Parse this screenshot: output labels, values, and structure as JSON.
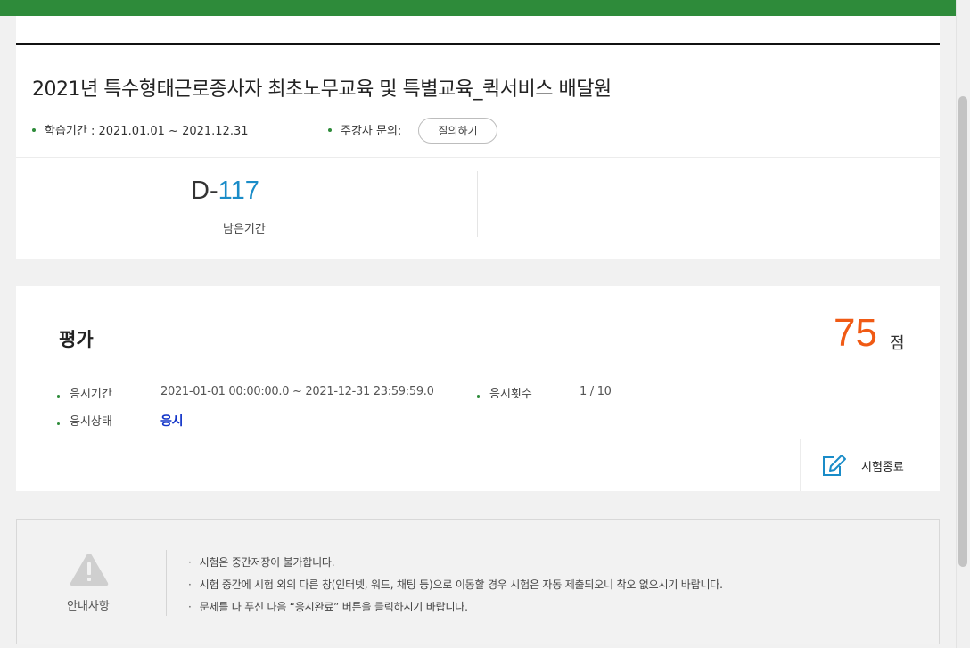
{
  "course": {
    "title": "2021년 특수형태근로종사자 최초노무교육 및 특별교육_퀵서비스 배달원",
    "period": "학습기간 : 2021.01.01 ~ 2021.12.31",
    "qna_label": "주강사 문의:",
    "qna_button": "질의하기",
    "dday_prefix": "D-",
    "dday_value": "117",
    "remaining_label": "남은기간"
  },
  "evaluation": {
    "title": "평가",
    "score": "75",
    "score_unit": "점",
    "period_label": "응시기간",
    "period_value": "2021-01-01 00:00:00.0 ~ 2021-12-31 23:59:59.0",
    "attempts_label": "응시횟수",
    "attempts_value": "1 / 10",
    "status_label": "응시상태",
    "status_value": "응시",
    "end_button": "시험종료"
  },
  "notice": {
    "label": "안내사항",
    "items": [
      "시험은 중간저장이 불가합니다.",
      "시험 중간에 시험 외의 다른 창(인터넷, 워드, 채팅 등)으로 이동할 경우 시험은 자동 제출되오니 착오 없으시기 바랍니다.",
      "문제를 다 푸신 다음 “응시완료” 버튼을 클릭하시기 바랍니다."
    ]
  },
  "colors": {
    "brand_green": "#2e8b3a",
    "dday_blue": "#1a8cc8",
    "score_orange": "#f05a14",
    "status_blue": "#1234c8"
  },
  "icons": {
    "end_exam": "pencil-edit-icon",
    "notice": "warning-triangle-icon"
  }
}
